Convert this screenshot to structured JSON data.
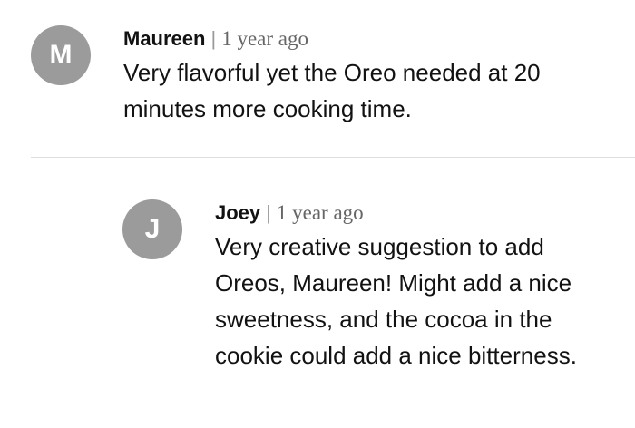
{
  "comments": [
    {
      "avatar_letter": "M",
      "author": "Maureen",
      "separator": "|",
      "time": "1 year ago",
      "text": "Very flavorful yet the Oreo needed at 20 minutes more cooking time."
    },
    {
      "avatar_letter": "J",
      "author": "Joey",
      "separator": "|",
      "time": "1 year ago",
      "text": "Very creative suggestion to add Oreos, Maureen! Might add a nice sweetness, and the cocoa in the cookie could add a nice bitterness."
    }
  ],
  "colors": {
    "avatar_bg": "#9b9b9b",
    "text": "#121212",
    "meta": "#666666",
    "divider": "#dedede"
  }
}
